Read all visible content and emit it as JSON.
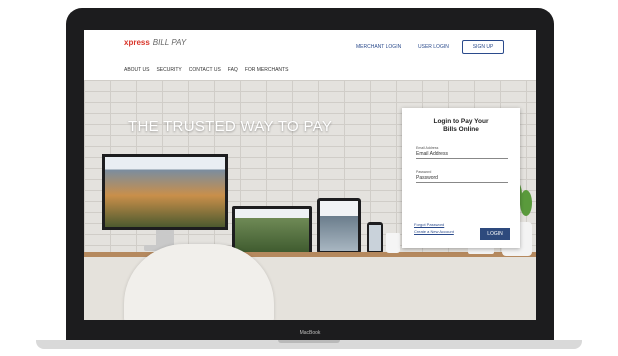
{
  "laptop": {
    "brand": "MacBook"
  },
  "header": {
    "logo_main": "xpress",
    "logo_sub": "BILL PAY",
    "merchant_login": "MERCHANT LOGIN",
    "user_login": "USER LOGIN",
    "sign_up": "SIGN UP"
  },
  "nav": {
    "items": [
      {
        "label": "ABOUT US"
      },
      {
        "label": "SECURITY"
      },
      {
        "label": "CONTACT US"
      },
      {
        "label": "FAQ"
      },
      {
        "label": "FOR MERCHANTS"
      }
    ]
  },
  "hero": {
    "headline": "THE TRUSTED WAY TO PAY"
  },
  "login_card": {
    "title_line1": "Login to Pay Your",
    "title_line2": "Bills Online",
    "email_label": "Email Address",
    "email_value": "Email Address",
    "password_label": "Password",
    "password_value": "Password",
    "forgot_password": "Forgot Password",
    "create_account": "Create a New Account",
    "login_button": "LOGIN"
  },
  "colors": {
    "brand_red": "#d9362b",
    "link_blue": "#2b4b8c",
    "button_blue": "#2e4a7d",
    "bezel": "#1c1c1e"
  }
}
